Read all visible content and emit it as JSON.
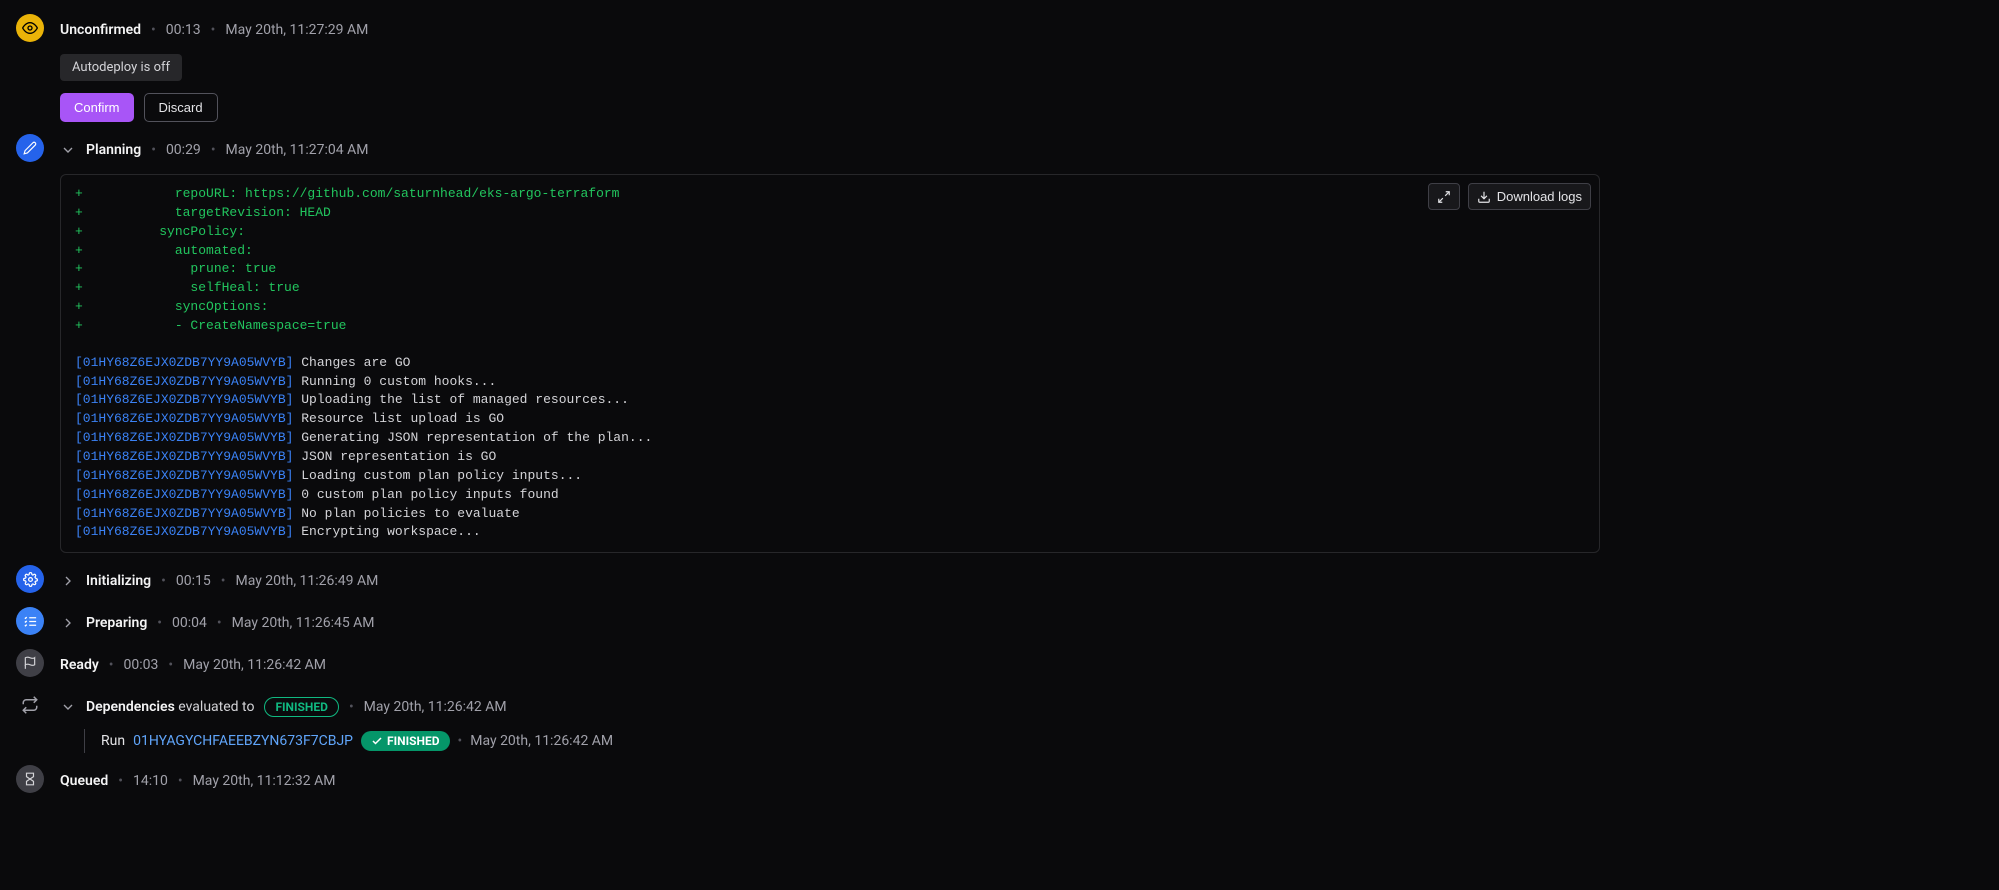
{
  "stages": {
    "unconfirmed": {
      "title": "Unconfirmed",
      "duration": "00:13",
      "timestamp": "May 20th, 11:27:29 AM",
      "autodeploy_badge": "Autodeploy is off",
      "confirm_label": "Confirm",
      "discard_label": "Discard"
    },
    "planning": {
      "title": "Planning",
      "duration": "00:29",
      "timestamp": "May 20th, 11:27:04 AM",
      "download_label": "Download logs",
      "diff_lines": [
        "           repoURL: https://github.com/saturnhead/eks-argo-terraform",
        "           targetRevision: HEAD",
        "         syncPolicy:",
        "           automated:",
        "             prune: true",
        "             selfHeal: true",
        "           syncOptions:",
        "           - CreateNamespace=true"
      ],
      "log_id": "[01HY68Z6EJX0ZDB7YY9A05WVYB]",
      "log_messages": [
        "Changes are GO",
        "Running 0 custom hooks...",
        "Uploading the list of managed resources...",
        "Resource list upload is GO",
        "Generating JSON representation of the plan...",
        "JSON representation is GO",
        "Loading custom plan policy inputs...",
        "0 custom plan policy inputs found",
        "No plan policies to evaluate",
        "Encrypting workspace..."
      ]
    },
    "initializing": {
      "title": "Initializing",
      "duration": "00:15",
      "timestamp": "May 20th, 11:26:49 AM"
    },
    "preparing": {
      "title": "Preparing",
      "duration": "00:04",
      "timestamp": "May 20th, 11:26:45 AM"
    },
    "ready": {
      "title": "Ready",
      "duration": "00:03",
      "timestamp": "May 20th, 11:26:42 AM"
    },
    "dependencies": {
      "title": "Dependencies",
      "evaluated_text": "evaluated to",
      "status": "FINISHED",
      "timestamp": "May 20th, 11:26:42 AM",
      "run_label": "Run",
      "run_id": "01HYAGYCHFAEEBZYN673F7CBJP",
      "run_status": "FINISHED",
      "run_timestamp": "May 20th, 11:26:42 AM"
    },
    "queued": {
      "title": "Queued",
      "duration": "14:10",
      "timestamp": "May 20th, 11:12:32 AM"
    }
  }
}
